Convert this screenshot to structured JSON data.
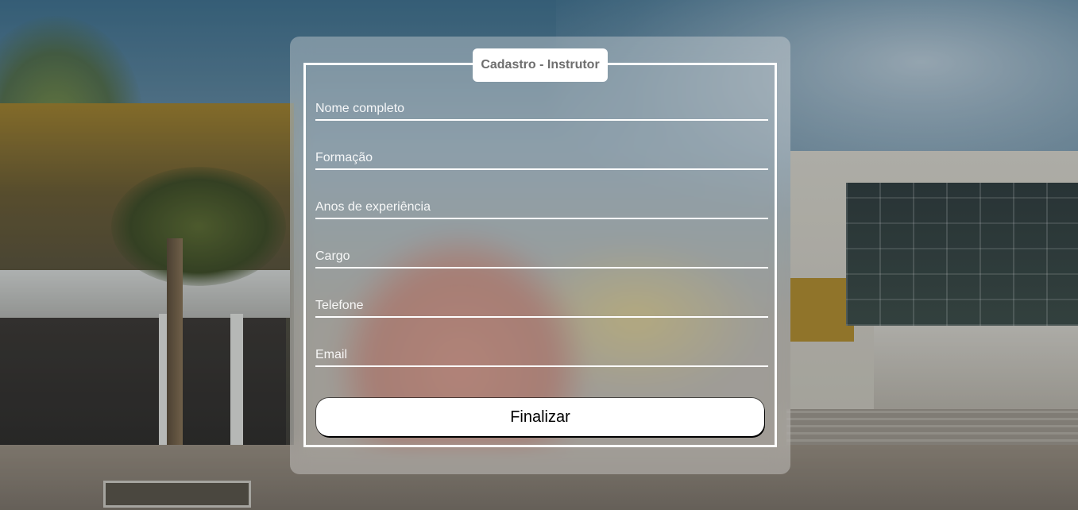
{
  "form": {
    "legend": "Cadastro - Instrutor",
    "fields": [
      {
        "placeholder": "Nome completo",
        "value": ""
      },
      {
        "placeholder": "Formação",
        "value": ""
      },
      {
        "placeholder": "Anos de experiência",
        "value": ""
      },
      {
        "placeholder": "Cargo",
        "value": ""
      },
      {
        "placeholder": "Telefone",
        "value": ""
      },
      {
        "placeholder": "Email",
        "value": ""
      }
    ],
    "submit_label": "Finalizar"
  },
  "colors": {
    "card_background": "#e1e1e1",
    "border": "#ffffff",
    "legend_text": "#6e6e6e",
    "field_text": "#ffffff",
    "button_background": "#ffffff",
    "button_text": "#000000"
  }
}
